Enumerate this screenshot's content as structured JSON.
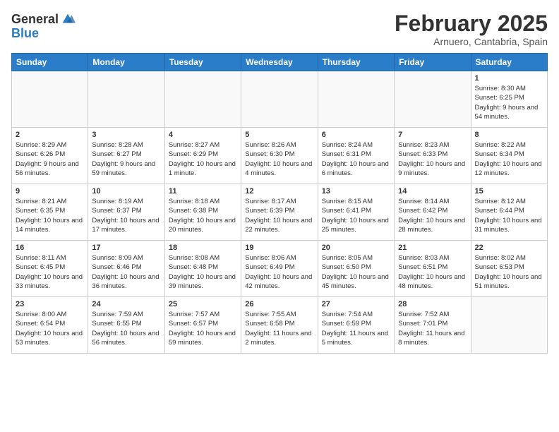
{
  "header": {
    "logo_general": "General",
    "logo_blue": "Blue",
    "title": "February 2025",
    "subtitle": "Arnuero, Cantabria, Spain"
  },
  "days_of_week": [
    "Sunday",
    "Monday",
    "Tuesday",
    "Wednesday",
    "Thursday",
    "Friday",
    "Saturday"
  ],
  "weeks": [
    [
      {
        "day": "",
        "info": ""
      },
      {
        "day": "",
        "info": ""
      },
      {
        "day": "",
        "info": ""
      },
      {
        "day": "",
        "info": ""
      },
      {
        "day": "",
        "info": ""
      },
      {
        "day": "",
        "info": ""
      },
      {
        "day": "1",
        "info": "Sunrise: 8:30 AM\nSunset: 6:25 PM\nDaylight: 9 hours and 54 minutes."
      }
    ],
    [
      {
        "day": "2",
        "info": "Sunrise: 8:29 AM\nSunset: 6:26 PM\nDaylight: 9 hours and 56 minutes."
      },
      {
        "day": "3",
        "info": "Sunrise: 8:28 AM\nSunset: 6:27 PM\nDaylight: 9 hours and 59 minutes."
      },
      {
        "day": "4",
        "info": "Sunrise: 8:27 AM\nSunset: 6:29 PM\nDaylight: 10 hours and 1 minute."
      },
      {
        "day": "5",
        "info": "Sunrise: 8:26 AM\nSunset: 6:30 PM\nDaylight: 10 hours and 4 minutes."
      },
      {
        "day": "6",
        "info": "Sunrise: 8:24 AM\nSunset: 6:31 PM\nDaylight: 10 hours and 6 minutes."
      },
      {
        "day": "7",
        "info": "Sunrise: 8:23 AM\nSunset: 6:33 PM\nDaylight: 10 hours and 9 minutes."
      },
      {
        "day": "8",
        "info": "Sunrise: 8:22 AM\nSunset: 6:34 PM\nDaylight: 10 hours and 12 minutes."
      }
    ],
    [
      {
        "day": "9",
        "info": "Sunrise: 8:21 AM\nSunset: 6:35 PM\nDaylight: 10 hours and 14 minutes."
      },
      {
        "day": "10",
        "info": "Sunrise: 8:19 AM\nSunset: 6:37 PM\nDaylight: 10 hours and 17 minutes."
      },
      {
        "day": "11",
        "info": "Sunrise: 8:18 AM\nSunset: 6:38 PM\nDaylight: 10 hours and 20 minutes."
      },
      {
        "day": "12",
        "info": "Sunrise: 8:17 AM\nSunset: 6:39 PM\nDaylight: 10 hours and 22 minutes."
      },
      {
        "day": "13",
        "info": "Sunrise: 8:15 AM\nSunset: 6:41 PM\nDaylight: 10 hours and 25 minutes."
      },
      {
        "day": "14",
        "info": "Sunrise: 8:14 AM\nSunset: 6:42 PM\nDaylight: 10 hours and 28 minutes."
      },
      {
        "day": "15",
        "info": "Sunrise: 8:12 AM\nSunset: 6:44 PM\nDaylight: 10 hours and 31 minutes."
      }
    ],
    [
      {
        "day": "16",
        "info": "Sunrise: 8:11 AM\nSunset: 6:45 PM\nDaylight: 10 hours and 33 minutes."
      },
      {
        "day": "17",
        "info": "Sunrise: 8:09 AM\nSunset: 6:46 PM\nDaylight: 10 hours and 36 minutes."
      },
      {
        "day": "18",
        "info": "Sunrise: 8:08 AM\nSunset: 6:48 PM\nDaylight: 10 hours and 39 minutes."
      },
      {
        "day": "19",
        "info": "Sunrise: 8:06 AM\nSunset: 6:49 PM\nDaylight: 10 hours and 42 minutes."
      },
      {
        "day": "20",
        "info": "Sunrise: 8:05 AM\nSunset: 6:50 PM\nDaylight: 10 hours and 45 minutes."
      },
      {
        "day": "21",
        "info": "Sunrise: 8:03 AM\nSunset: 6:51 PM\nDaylight: 10 hours and 48 minutes."
      },
      {
        "day": "22",
        "info": "Sunrise: 8:02 AM\nSunset: 6:53 PM\nDaylight: 10 hours and 51 minutes."
      }
    ],
    [
      {
        "day": "23",
        "info": "Sunrise: 8:00 AM\nSunset: 6:54 PM\nDaylight: 10 hours and 53 minutes."
      },
      {
        "day": "24",
        "info": "Sunrise: 7:59 AM\nSunset: 6:55 PM\nDaylight: 10 hours and 56 minutes."
      },
      {
        "day": "25",
        "info": "Sunrise: 7:57 AM\nSunset: 6:57 PM\nDaylight: 10 hours and 59 minutes."
      },
      {
        "day": "26",
        "info": "Sunrise: 7:55 AM\nSunset: 6:58 PM\nDaylight: 11 hours and 2 minutes."
      },
      {
        "day": "27",
        "info": "Sunrise: 7:54 AM\nSunset: 6:59 PM\nDaylight: 11 hours and 5 minutes."
      },
      {
        "day": "28",
        "info": "Sunrise: 7:52 AM\nSunset: 7:01 PM\nDaylight: 11 hours and 8 minutes."
      },
      {
        "day": "",
        "info": ""
      }
    ]
  ]
}
